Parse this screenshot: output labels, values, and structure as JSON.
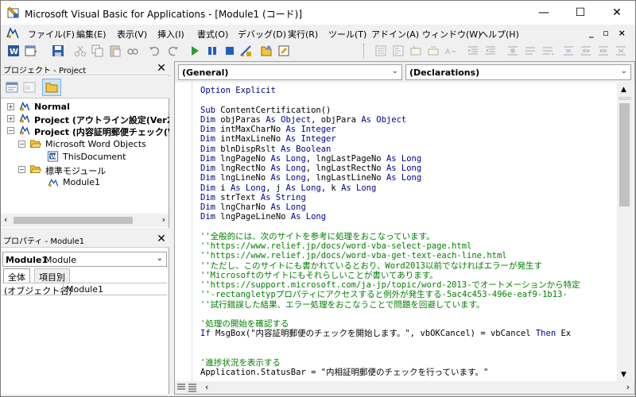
{
  "window": {
    "title": "Microsoft Visual Basic for Applications - [Module1 (コード)]",
    "minimize_label": "—",
    "maximize_label": "☐",
    "close_label": "✕"
  },
  "menu": {
    "items": [
      "ファイル(F)",
      "編集(E)",
      "表示(V)",
      "挿入(I)",
      "書式(O)",
      "デバッグ(D)",
      "実行(R)",
      "ツール(T)",
      "アドイン(A)",
      "ウィンドウ(W)",
      "ヘルプ(H)"
    ],
    "doc_restore": "_ ▫ ×"
  },
  "project_pane": {
    "title": "プロジェクト - Project",
    "tree": [
      {
        "label": "Normal",
        "bold": true,
        "expander": "+",
        "level": 0
      },
      {
        "label": "Project (アウトライン設定(Ver20",
        "bold": true,
        "expander": "+",
        "level": 0
      },
      {
        "label": "Project (内容証明郵便チェック(Ve",
        "bold": true,
        "expander": "−",
        "level": 0
      },
      {
        "label": "Microsoft Word Objects",
        "bold": false,
        "expander": "−",
        "level": 1
      },
      {
        "label": "ThisDocument",
        "bold": false,
        "expander": "",
        "level": 2
      },
      {
        "label": "標準モジュール",
        "bold": false,
        "expander": "−",
        "level": 1
      },
      {
        "label": "Module1",
        "bold": false,
        "expander": "",
        "level": 2
      }
    ]
  },
  "properties_pane": {
    "title": "プロパティ - Module1",
    "object_name": "Module1",
    "object_type": "Module",
    "tabs": [
      "全体",
      "項目別"
    ],
    "row_name": "(オブジェクト名)",
    "row_value": "Module1"
  },
  "code_window": {
    "object_combo": "(General)",
    "procedure_combo": "(Declarations)",
    "lines": [
      [
        {
          "t": "kw",
          "s": "Option Explicit"
        }
      ],
      [],
      [
        {
          "t": "kw",
          "s": "Sub "
        },
        {
          "t": "pl",
          "s": "ContentCertification()"
        }
      ],
      [
        {
          "t": "kw",
          "s": "Dim "
        },
        {
          "t": "pl",
          "s": "objParas "
        },
        {
          "t": "kw",
          "s": "As Object"
        },
        {
          "t": "pl",
          "s": ", objPara "
        },
        {
          "t": "kw",
          "s": "As Object"
        }
      ],
      [
        {
          "t": "kw",
          "s": "Dim "
        },
        {
          "t": "pl",
          "s": "intMaxCharNo "
        },
        {
          "t": "kw",
          "s": "As Integer"
        }
      ],
      [
        {
          "t": "kw",
          "s": "Dim "
        },
        {
          "t": "pl",
          "s": "intMaxLineNo "
        },
        {
          "t": "kw",
          "s": "As Integer"
        }
      ],
      [
        {
          "t": "kw",
          "s": "Dim "
        },
        {
          "t": "pl",
          "s": "blnDispRslt "
        },
        {
          "t": "kw",
          "s": "As Boolean"
        }
      ],
      [
        {
          "t": "kw",
          "s": "Dim "
        },
        {
          "t": "pl",
          "s": "lngPageNo "
        },
        {
          "t": "kw",
          "s": "As Long"
        },
        {
          "t": "pl",
          "s": ", lngLastPageNo "
        },
        {
          "t": "kw",
          "s": "As Long"
        }
      ],
      [
        {
          "t": "kw",
          "s": "Dim "
        },
        {
          "t": "pl",
          "s": "lngRectNo "
        },
        {
          "t": "kw",
          "s": "As Long"
        },
        {
          "t": "pl",
          "s": ", lngLastRectNo "
        },
        {
          "t": "kw",
          "s": "As Long"
        }
      ],
      [
        {
          "t": "kw",
          "s": "Dim "
        },
        {
          "t": "pl",
          "s": "lngLineNo "
        },
        {
          "t": "kw",
          "s": "As Long"
        },
        {
          "t": "pl",
          "s": ", lngLastLineNo "
        },
        {
          "t": "kw",
          "s": "As Long"
        }
      ],
      [
        {
          "t": "kw",
          "s": "Dim "
        },
        {
          "t": "pl",
          "s": "i "
        },
        {
          "t": "kw",
          "s": "As Long"
        },
        {
          "t": "pl",
          "s": ", j "
        },
        {
          "t": "kw",
          "s": "As Long"
        },
        {
          "t": "pl",
          "s": ", k "
        },
        {
          "t": "kw",
          "s": "As Long"
        }
      ],
      [
        {
          "t": "kw",
          "s": "Dim "
        },
        {
          "t": "pl",
          "s": "strText "
        },
        {
          "t": "kw",
          "s": "As String"
        }
      ],
      [
        {
          "t": "kw",
          "s": "Dim "
        },
        {
          "t": "pl",
          "s": "lngCharNo "
        },
        {
          "t": "kw",
          "s": "As Long"
        }
      ],
      [
        {
          "t": "kw",
          "s": "Dim "
        },
        {
          "t": "pl",
          "s": "lngPageLineNo "
        },
        {
          "t": "kw",
          "s": "As Long"
        }
      ],
      [],
      [
        {
          "t": "cm",
          "s": "''全般的には、次のサイトを参考に処理をおこなっています。"
        }
      ],
      [
        {
          "t": "cm",
          "s": "''https://www.relief.jp/docs/word-vba-select-page.html"
        }
      ],
      [
        {
          "t": "cm",
          "s": "''https://www.relief.jp/docs/word-vba-get-text-each-line.html"
        }
      ],
      [
        {
          "t": "cm",
          "s": "''ただし、このサイトにも書かれているとおり、Word2013以前でなければエラーが発生す"
        }
      ],
      [
        {
          "t": "cm",
          "s": "''Microsoftのサイトにもそれらしいことが書いてあります。"
        }
      ],
      [
        {
          "t": "cm",
          "s": "''https://support.microsoft.com/ja-jp/topic/word-2013-でオートメーションから特定"
        }
      ],
      [
        {
          "t": "cm",
          "s": "''-rectangletypプロパティにアクセスすると例外が発生する-5ac4c453-496e-eaf9-1b13-"
        }
      ],
      [
        {
          "t": "cm",
          "s": "''試行錯誤した結果、エラー処理をおこなうことで問題を回避しています。"
        }
      ],
      [],
      [
        {
          "t": "cm",
          "s": "'処理の開始を確認する"
        }
      ],
      [
        {
          "t": "kw",
          "s": "If "
        },
        {
          "t": "pl",
          "s": "MsgBox(\"内容証明郵便のチェックを開始します。\", vbOKCancel) = vbCancel "
        },
        {
          "t": "kw",
          "s": "Then "
        },
        {
          "t": "pl",
          "s": "Ex"
        }
      ],
      [],
      [],
      [
        {
          "t": "cm",
          "s": "'進捗状況を表示する"
        }
      ],
      [
        {
          "t": "pl",
          "s": "Application.StatusBar = \"内相証明郵便のチェックを行っています。\""
        }
      ]
    ]
  }
}
